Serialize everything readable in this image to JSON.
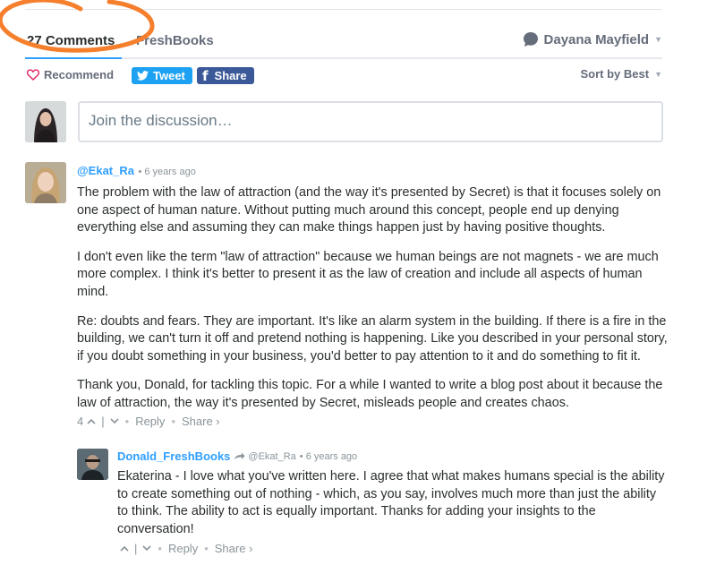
{
  "navbar": {
    "comments_count": "27 Comments",
    "community": "FreshBooks",
    "user_name": "Dayana Mayfield"
  },
  "actions": {
    "recommend": "Recommend",
    "tweet": "Tweet",
    "share": "Share",
    "sort": "Sort by Best"
  },
  "compose": {
    "placeholder": "Join the discussion…"
  },
  "comments": [
    {
      "author": "@Ekat_Ra",
      "time": "• 6 years ago",
      "paragraphs": [
        "The problem with the law of attraction (and the way it's presented by Secret) is that it focuses solely on one aspect of human nature. Without putting much around this concept, people end up denying everything else and assuming they can make things happen just by having positive thoughts.",
        "I don't even like the term \"law of attraction\" because we human beings are not magnets - we are much more complex. I think it's better to present it as the law of creation and include all aspects of human mind.",
        "Re: doubts and fears. They are important. It's like an alarm system in the building. If there is a fire in the building, we can't turn it off and pretend nothing is happening. Like you described in your personal story, if you doubt something in your business, you'd better to pay attention to it and do something to fit it.",
        "Thank you, Donald, for tackling this topic. For a while I wanted to write a blog post about it because the law of attraction, the way it's presented by Secret, misleads people and creates chaos."
      ],
      "votes": "4",
      "reply": "Reply",
      "share": "Share ›"
    },
    {
      "author": "Donald_FreshBooks",
      "parent": "@Ekat_Ra",
      "time": "• 6 years ago",
      "paragraphs": [
        "Ekaterina - I love what you've written here. I agree that what makes humans special is the ability to create something out of nothing - which, as you say, involves much more than just the ability to think. The ability to act is equally important. Thanks for adding your insights to the conversation!"
      ],
      "votes": "",
      "reply": "Reply",
      "share": "Share ›"
    }
  ],
  "colors": {
    "accent": "#2e9fff",
    "tweet": "#1da1f2",
    "facebook": "#3b5998",
    "annotation": "#f57f2c"
  }
}
